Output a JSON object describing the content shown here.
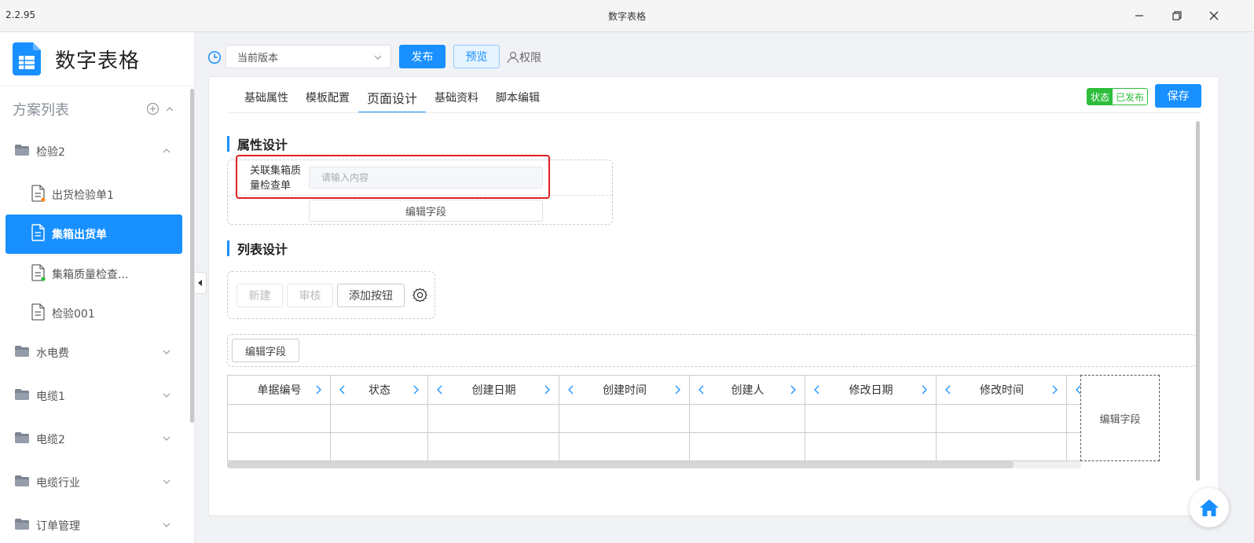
{
  "window": {
    "version": "2.2.95",
    "title": "数字表格"
  },
  "sidebar": {
    "app_name": "数字表格",
    "plan_list_label": "方案列表",
    "folders": [
      {
        "label": "检验2",
        "expanded": true
      },
      {
        "label": "水电费",
        "expanded": false
      },
      {
        "label": "电缆1",
        "expanded": false
      },
      {
        "label": "电缆2",
        "expanded": false
      },
      {
        "label": "电缆行业",
        "expanded": false
      },
      {
        "label": "订单管理",
        "expanded": false
      }
    ],
    "files": [
      {
        "label": "出货检验单1",
        "dot": "orange"
      },
      {
        "label": "集箱出货单",
        "active": true
      },
      {
        "label": "集箱质量检查...",
        "dot": "green"
      },
      {
        "label": "检验001"
      }
    ]
  },
  "toolbar": {
    "version_select": "当前版本",
    "publish": "发布",
    "preview": "预览",
    "permission": "权限"
  },
  "tabs": [
    "基础属性",
    "模板配置",
    "页面设计",
    "基础资料",
    "脚本编辑"
  ],
  "active_tab": "页面设计",
  "status": {
    "key": "状态",
    "value": "已发布"
  },
  "save": "保存",
  "property_design": {
    "title": "属性设计",
    "field_label": "关联集箱质量检查单",
    "field_label_line1": "关联集箱质",
    "field_label_line2": "量检查单",
    "placeholder": "请输入内容",
    "edit_fields": "编辑字段"
  },
  "list_design": {
    "title": "列表设计",
    "buttons": [
      "新建",
      "审核",
      "添加按钮"
    ],
    "edit_fields": "编辑字段",
    "columns": [
      "单据编号",
      "状态",
      "创建日期",
      "创建时间",
      "创建人",
      "修改日期",
      "修改时间"
    ],
    "side_edit_fields": "编辑字段"
  },
  "colors": {
    "primary": "#1890ff",
    "success": "#2dbd3b",
    "highlight": "#e02020"
  }
}
